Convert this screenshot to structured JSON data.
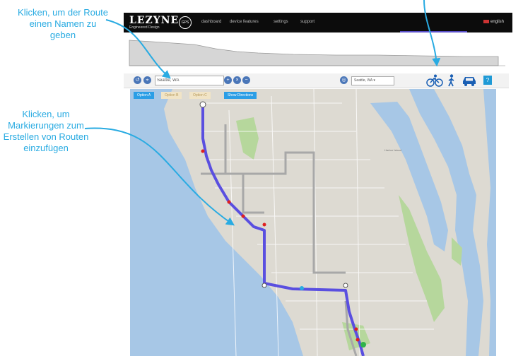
{
  "annotations": {
    "name_route": "Klicken, um der Route einen Namen zu geben",
    "add_markers": "Klicken, um Markierungen zum Erstellen von Routen einzufügen"
  },
  "header": {
    "logo": "LEZYNE",
    "logo_sub": "Engineered Design",
    "nav": [
      "dashboard",
      "device features",
      "settings",
      "support"
    ],
    "language": "english"
  },
  "toolbar": {
    "route_name_value": "Seattle, WA",
    "location_select": "Seattle, WA",
    "modes": [
      "bike-icon",
      "walk-icon",
      "car-icon"
    ],
    "help": "?"
  },
  "map": {
    "options": [
      "Option A",
      "Option B",
      "Option C"
    ],
    "show_directions": "Show Directions",
    "labels": [
      "Harbor Island"
    ]
  },
  "colors": {
    "accent": "#29abe2",
    "route": "#5a4fe0",
    "water": "#a7c7e6",
    "park": "#b6d79c"
  }
}
